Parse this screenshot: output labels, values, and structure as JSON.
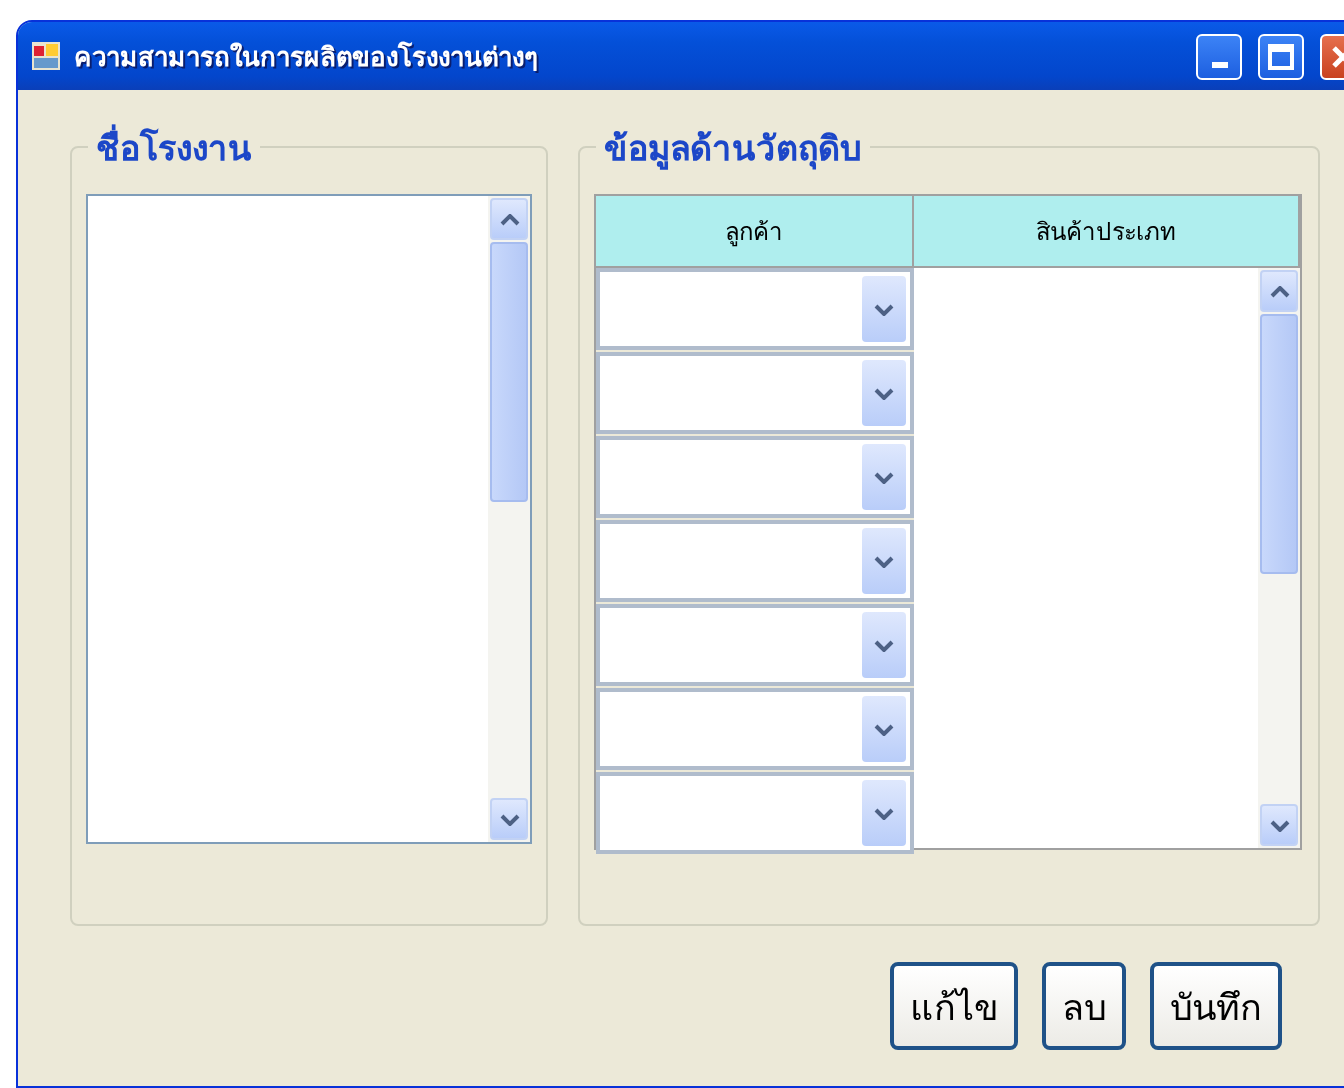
{
  "window": {
    "title": "ความสามารถในการผลิตของโรงงานต่างๆ"
  },
  "factory_group": {
    "title": "ชื่อโรงงาน"
  },
  "material_group": {
    "title": "ข้อมูลด้านวัตถุดิบ",
    "columns": [
      "ลูกค้า",
      "สินค้าประเภท"
    ]
  },
  "buttons": [
    "แก้ไข",
    "ลบ",
    "บันทึก"
  ]
}
